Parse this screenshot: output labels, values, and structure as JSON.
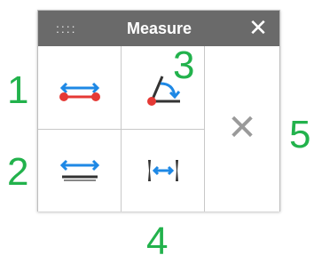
{
  "panel": {
    "grip_glyph": "::::",
    "title": "Measure",
    "close_glyph": "✕",
    "tools": [
      {
        "name": "distance",
        "icon": "distance-icon"
      },
      {
        "name": "angle",
        "icon": "angle-icon"
      },
      {
        "name": "surface-distance",
        "icon": "surface-distance-icon"
      },
      {
        "name": "gap",
        "icon": "gap-icon"
      }
    ],
    "clear_glyph": "✕"
  },
  "callouts": [
    "1",
    "2",
    "3",
    "4",
    "5"
  ],
  "colors": {
    "titlebar": "#6a6a6a",
    "accent_blue": "#1e88e5",
    "point_red": "#e53935",
    "callout_green": "#22b24c",
    "clear_gray": "#9a9a9a"
  }
}
